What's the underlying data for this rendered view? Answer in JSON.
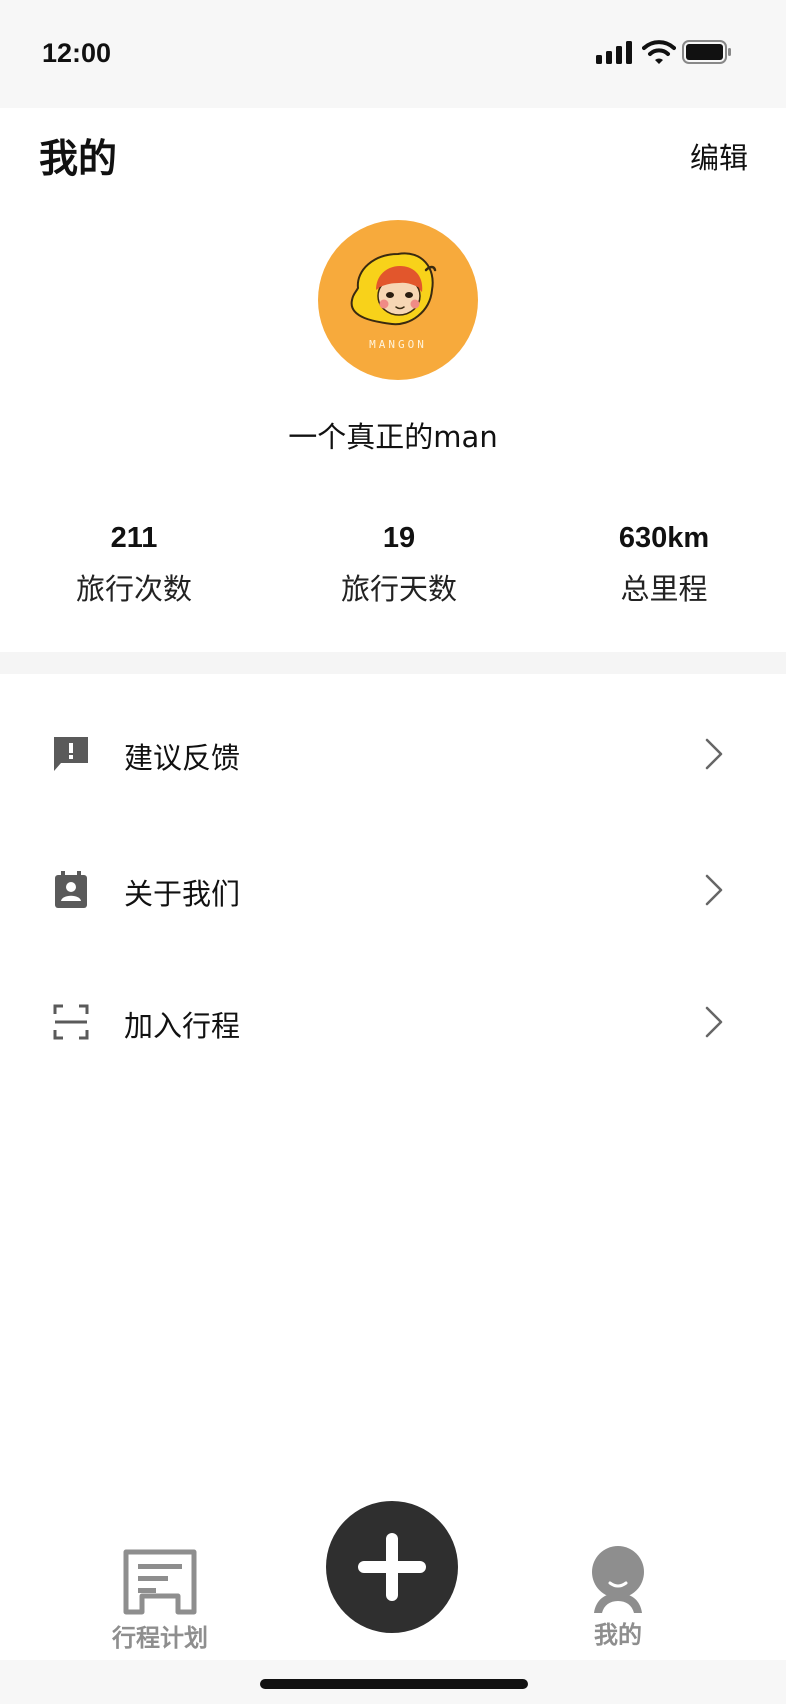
{
  "status_bar": {
    "time": "12:00",
    "icons": [
      "signal-icon",
      "wifi-icon",
      "battery-icon"
    ]
  },
  "header": {
    "title": "我的",
    "edit_label": "编辑"
  },
  "profile": {
    "avatar_brand": "MANGON",
    "username": "一个真正的man"
  },
  "stats": [
    {
      "value": "211",
      "label": "旅行次数"
    },
    {
      "value": "19",
      "label": "旅行天数"
    },
    {
      "value": "630km",
      "label": "总里程"
    }
  ],
  "menu": [
    {
      "label": "建议反馈",
      "icon": "feedback-icon"
    },
    {
      "label": "关于我们",
      "icon": "contact-card-icon"
    },
    {
      "label": "加入行程",
      "icon": "scan-icon"
    }
  ],
  "tab_bar": {
    "plan_label": "行程计划",
    "mine_label": "我的",
    "add_icon": "plus-icon"
  },
  "colors": {
    "avatar_bg": "#f7aa3c",
    "add_button_bg": "#2f2f2f",
    "tab_inactive": "#8e8e8e",
    "section_bg": "#f5f5f5"
  }
}
